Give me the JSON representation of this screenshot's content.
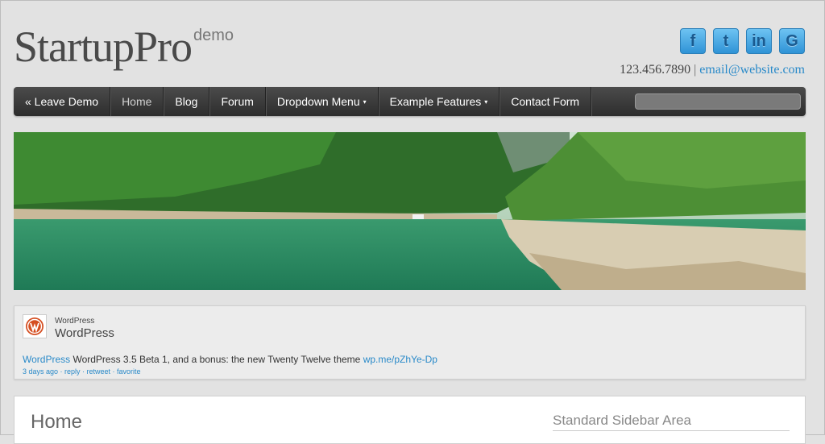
{
  "header": {
    "logo_main": "StartupPro",
    "logo_sub": "demo",
    "phone": "123.456.7890",
    "separator": "|",
    "email": "email@website.com",
    "social": [
      {
        "icon": "facebook-icon",
        "glyph": "f"
      },
      {
        "icon": "twitter-icon",
        "glyph": "t"
      },
      {
        "icon": "linkedin-icon",
        "glyph": "in"
      },
      {
        "icon": "google-icon",
        "glyph": "G"
      }
    ]
  },
  "nav": {
    "items": [
      {
        "label": "« Leave Demo"
      },
      {
        "label": "Home"
      },
      {
        "label": "Blog"
      },
      {
        "label": "Forum"
      },
      {
        "label": "Dropdown Menu"
      },
      {
        "label": "Example Features"
      },
      {
        "label": "Contact Form"
      }
    ],
    "caret": "▾",
    "search_placeholder": ""
  },
  "tweet": {
    "name_small": "WordPress",
    "name_big": "WordPress",
    "author_link": "WordPress",
    "text": " WordPress 3.5 Beta 1, and a bonus: the new Twenty Twelve theme ",
    "link": "wp.me/pZhYe-Dp",
    "meta": "3 days ago · reply · retweet · favorite"
  },
  "content": {
    "page_title": "Home",
    "sidebar_title": "Standard Sidebar Area"
  },
  "colors": {
    "accent": "#2a8ac9",
    "nav_bg": "#3a3a3a",
    "page_bg": "#e2e2e2"
  }
}
